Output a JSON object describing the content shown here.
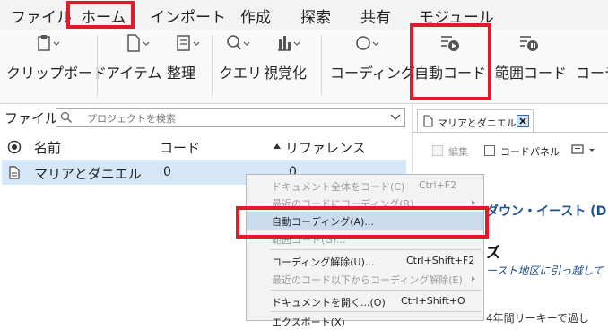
{
  "menu": [
    "ファイル",
    "ホーム",
    "インポート",
    "作成",
    "探索",
    "共有",
    "モジュール"
  ],
  "ribbon": {
    "clipboard": "クリップボード",
    "item": "アイテム",
    "organize": "整理",
    "query": "クエリ",
    "visualize": "視覚化",
    "coding": "コーディング",
    "auto_code": "自動コード",
    "range_code": "範囲コード",
    "more": "コーデ"
  },
  "left": {
    "title": "ファイル",
    "search_placeholder": "プロジェクトを検索",
    "col_name": "名前",
    "col_code": "コード",
    "col_ref": "リファレンス",
    "rows": [
      {
        "name": "マリアとダニエル",
        "code": "0",
        "ref": "0"
      }
    ]
  },
  "right": {
    "tab_title": "マリアとダニエル",
    "edit": "編集",
    "code_panel": "コードパネル",
    "text1": "ダウン・イースト (D",
    "text2": "ズ",
    "text3": "ースト地区に引っ越して",
    "text4": "4年間リーキーで過し"
  },
  "context_menu": [
    {
      "label": "ドキュメント全体をコード(C)",
      "key": "Ctrl+F2"
    },
    {
      "label": "最近のコードにコーディング(R)",
      "key": ""
    },
    {
      "label": "自動コーディング(A)...",
      "key": ""
    },
    {
      "label": "範囲コード(G)...",
      "key": ""
    },
    {
      "label": "コーディング解除(U)...",
      "key": "Ctrl+Shift+F2"
    },
    {
      "label": "最近のコード以下からコーディング解除(E)",
      "key": ""
    },
    {
      "label": "ドキュメントを開く...(O)",
      "key": "Ctrl+Shift+O"
    },
    {
      "label": "エクスポート(X)",
      "key": ""
    }
  ],
  "colors": {
    "highlight_red": "#e01a2a",
    "selected_row": "#d5e7f7"
  }
}
